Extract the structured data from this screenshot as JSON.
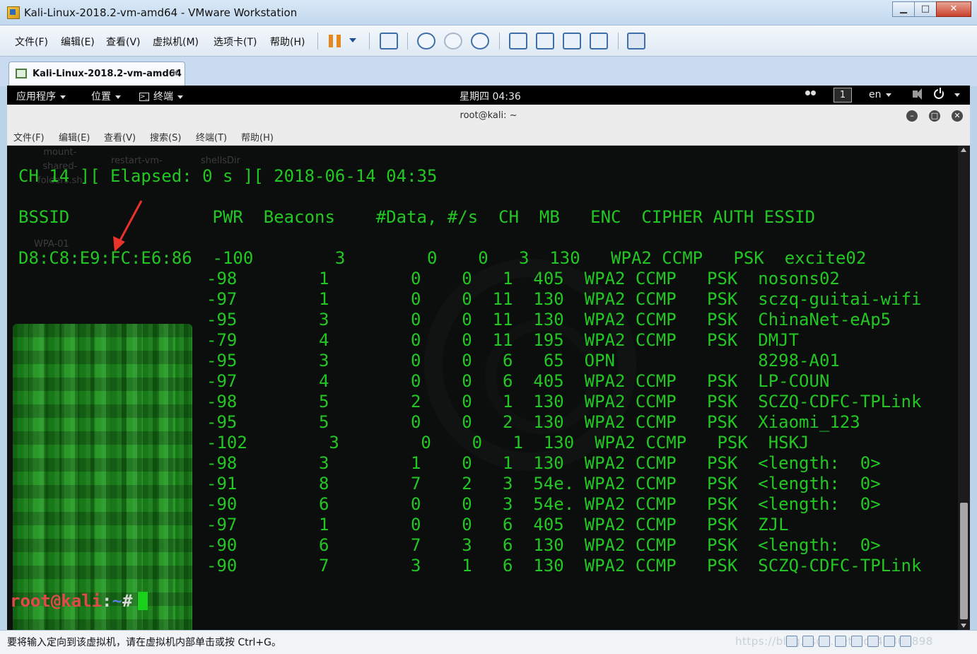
{
  "window": {
    "title": "Kali-Linux-2018.2-vm-amd64 - VMware Workstation",
    "min": "▁",
    "max": "□",
    "close": "✕"
  },
  "menu": {
    "file": "文件(F)",
    "edit": "编辑(E)",
    "view": "查看(V)",
    "vm": "虚拟机(M)",
    "tabs": "选项卡(T)",
    "help": "帮助(H)"
  },
  "tab": {
    "label": "Kali-Linux-2018.2-vm-amd64",
    "close": "✕"
  },
  "gnome": {
    "apps": "应用程序",
    "places": "位置",
    "terminal": "终端",
    "clock": "星期四 04:36",
    "workspace": "1",
    "lang": "en"
  },
  "terminal": {
    "title": "root@kali: ~",
    "menu": {
      "file": "文件(F)",
      "edit": "编辑(E)",
      "view": "查看(V)",
      "search": "搜索(S)",
      "terminal": "终端(T)",
      "help": "帮助(H)"
    },
    "desktop_icons": {
      "mount": "mount-",
      "shared": "shared-",
      "folders": "folders.sh",
      "restart": "restart-vm-",
      "shellsdir": "shellsDir",
      "wpa": "WPA-01"
    },
    "status_line": "CH 14 ][ Elapsed: 0 s ][ 2018-06-14 04:35",
    "header_line": "BSSID              PWR  Beacons    #Data, #/s  CH  MB   ENC  CIPHER AUTH ESSID",
    "first_row": "D8:C8:E9:FC:E6:86  -100        3        0    0   3  130   WPA2 CCMP   PSK  excite02",
    "rows": [
      "-98        1        0    0   1  405  WPA2 CCMP   PSK  nosons02",
      "-97        1        0    0  11  130  WPA2 CCMP   PSK  sczq-guitai-wifi",
      "-95        3        0    0  11  130  WPA2 CCMP   PSK  ChinaNet-eAp5",
      "-79        4        0    0  11  195  WPA2 CCMP   PSK  DMJT",
      "-95        3        0    0   6   65  OPN              8298-A01",
      "-97        4        0    0   6  405  WPA2 CCMP   PSK  LP-COUN",
      "-98        5        2    0   1  130  WPA2 CCMP   PSK  SCZQ-CDFC-TPLink",
      "-95        5        0    0   2  130  WPA2 CCMP   PSK  Xiaomi_123",
      "-102        3        0    0   1  130  WPA2 CCMP   PSK  HSKJ",
      "-98        3        1    0   1  130  WPA2 CCMP   PSK  <length:  0>",
      "-91        8        7    2   3  54e. WPA2 CCMP   PSK  <length:  0>",
      "-90        6        0    0   3  54e. WPA2 CCMP   PSK  <length:  0>",
      "-97        1        0    0   6  405  WPA2 CCMP   PSK  ZJL",
      "-90        6        7    3   6  130  WPA2 CCMP   PSK  <length:  0>",
      "-90        7        3    1   6  130  WPA2 CCMP   PSK  SCZQ-CDFC-TPLink"
    ],
    "prompt_user": "root@kali",
    "prompt_sep": ":",
    "prompt_path": "~",
    "prompt_symbol": "#"
  },
  "statusbar": {
    "message": "要将输入定向到该虚拟机，请在虚拟机内部单击或按 Ctrl+G。",
    "watermark": "https://blog.csdn.net/qq_42367898"
  },
  "colors": {
    "terminal_green": "#23c723",
    "prompt_red": "#e24a4a",
    "arrow_red": "#e8322a"
  }
}
